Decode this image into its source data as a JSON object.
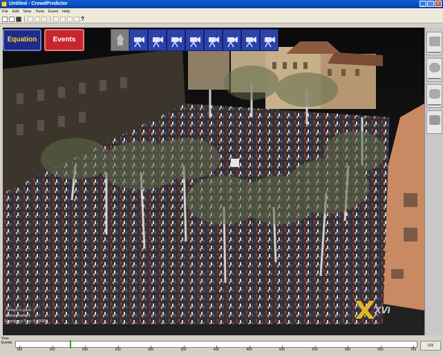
{
  "window": {
    "title": "Untitled - CrowdPredictor",
    "controls": [
      "_",
      "□",
      "x"
    ]
  },
  "menu": {
    "items": [
      "File",
      "Edit",
      "View",
      "Tools",
      "Event",
      "Help"
    ]
  },
  "overlay": {
    "equation_label": "Equation",
    "events_label": "Events",
    "camera_count": 8
  },
  "status": {
    "humans_in_panic": "Humans in panic: 3",
    "humans_safe": "Humans safe: 0",
    "emergency_time": "Emergency Time: 0.000000"
  },
  "logo": {
    "text": "XVR"
  },
  "timeline": {
    "label_top": "Time",
    "label_bottom": "Events",
    "ticks": [
      "100",
      "150",
      "200",
      "250",
      "300",
      "350",
      "400",
      "450",
      "500",
      "550",
      "600",
      "650",
      "700"
    ],
    "cursor_fraction": 0.135,
    "right_value": "(20)"
  },
  "colors": {
    "equation_bg": "#1f2b8a",
    "events_bg": "#c7262d",
    "camera_bg": "#2b42a8",
    "timeline_cursor": "#2aa12a"
  }
}
